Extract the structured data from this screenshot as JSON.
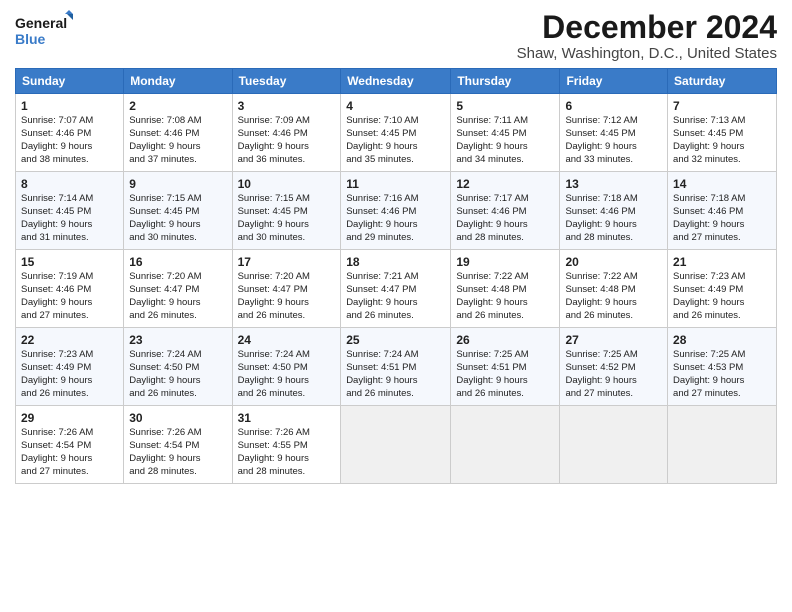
{
  "logo": {
    "line1": "General",
    "line2": "Blue"
  },
  "title": "December 2024",
  "location": "Shaw, Washington, D.C., United States",
  "days_of_week": [
    "Sunday",
    "Monday",
    "Tuesday",
    "Wednesday",
    "Thursday",
    "Friday",
    "Saturday"
  ],
  "weeks": [
    [
      {
        "day": "1",
        "info": "Sunrise: 7:07 AM\nSunset: 4:46 PM\nDaylight: 9 hours\nand 38 minutes."
      },
      {
        "day": "2",
        "info": "Sunrise: 7:08 AM\nSunset: 4:46 PM\nDaylight: 9 hours\nand 37 minutes."
      },
      {
        "day": "3",
        "info": "Sunrise: 7:09 AM\nSunset: 4:46 PM\nDaylight: 9 hours\nand 36 minutes."
      },
      {
        "day": "4",
        "info": "Sunrise: 7:10 AM\nSunset: 4:45 PM\nDaylight: 9 hours\nand 35 minutes."
      },
      {
        "day": "5",
        "info": "Sunrise: 7:11 AM\nSunset: 4:45 PM\nDaylight: 9 hours\nand 34 minutes."
      },
      {
        "day": "6",
        "info": "Sunrise: 7:12 AM\nSunset: 4:45 PM\nDaylight: 9 hours\nand 33 minutes."
      },
      {
        "day": "7",
        "info": "Sunrise: 7:13 AM\nSunset: 4:45 PM\nDaylight: 9 hours\nand 32 minutes."
      }
    ],
    [
      {
        "day": "8",
        "info": "Sunrise: 7:14 AM\nSunset: 4:45 PM\nDaylight: 9 hours\nand 31 minutes."
      },
      {
        "day": "9",
        "info": "Sunrise: 7:15 AM\nSunset: 4:45 PM\nDaylight: 9 hours\nand 30 minutes."
      },
      {
        "day": "10",
        "info": "Sunrise: 7:15 AM\nSunset: 4:45 PM\nDaylight: 9 hours\nand 30 minutes."
      },
      {
        "day": "11",
        "info": "Sunrise: 7:16 AM\nSunset: 4:46 PM\nDaylight: 9 hours\nand 29 minutes."
      },
      {
        "day": "12",
        "info": "Sunrise: 7:17 AM\nSunset: 4:46 PM\nDaylight: 9 hours\nand 28 minutes."
      },
      {
        "day": "13",
        "info": "Sunrise: 7:18 AM\nSunset: 4:46 PM\nDaylight: 9 hours\nand 28 minutes."
      },
      {
        "day": "14",
        "info": "Sunrise: 7:18 AM\nSunset: 4:46 PM\nDaylight: 9 hours\nand 27 minutes."
      }
    ],
    [
      {
        "day": "15",
        "info": "Sunrise: 7:19 AM\nSunset: 4:46 PM\nDaylight: 9 hours\nand 27 minutes."
      },
      {
        "day": "16",
        "info": "Sunrise: 7:20 AM\nSunset: 4:47 PM\nDaylight: 9 hours\nand 26 minutes."
      },
      {
        "day": "17",
        "info": "Sunrise: 7:20 AM\nSunset: 4:47 PM\nDaylight: 9 hours\nand 26 minutes."
      },
      {
        "day": "18",
        "info": "Sunrise: 7:21 AM\nSunset: 4:47 PM\nDaylight: 9 hours\nand 26 minutes."
      },
      {
        "day": "19",
        "info": "Sunrise: 7:22 AM\nSunset: 4:48 PM\nDaylight: 9 hours\nand 26 minutes."
      },
      {
        "day": "20",
        "info": "Sunrise: 7:22 AM\nSunset: 4:48 PM\nDaylight: 9 hours\nand 26 minutes."
      },
      {
        "day": "21",
        "info": "Sunrise: 7:23 AM\nSunset: 4:49 PM\nDaylight: 9 hours\nand 26 minutes."
      }
    ],
    [
      {
        "day": "22",
        "info": "Sunrise: 7:23 AM\nSunset: 4:49 PM\nDaylight: 9 hours\nand 26 minutes."
      },
      {
        "day": "23",
        "info": "Sunrise: 7:24 AM\nSunset: 4:50 PM\nDaylight: 9 hours\nand 26 minutes."
      },
      {
        "day": "24",
        "info": "Sunrise: 7:24 AM\nSunset: 4:50 PM\nDaylight: 9 hours\nand 26 minutes."
      },
      {
        "day": "25",
        "info": "Sunrise: 7:24 AM\nSunset: 4:51 PM\nDaylight: 9 hours\nand 26 minutes."
      },
      {
        "day": "26",
        "info": "Sunrise: 7:25 AM\nSunset: 4:51 PM\nDaylight: 9 hours\nand 26 minutes."
      },
      {
        "day": "27",
        "info": "Sunrise: 7:25 AM\nSunset: 4:52 PM\nDaylight: 9 hours\nand 27 minutes."
      },
      {
        "day": "28",
        "info": "Sunrise: 7:25 AM\nSunset: 4:53 PM\nDaylight: 9 hours\nand 27 minutes."
      }
    ],
    [
      {
        "day": "29",
        "info": "Sunrise: 7:26 AM\nSunset: 4:54 PM\nDaylight: 9 hours\nand 27 minutes."
      },
      {
        "day": "30",
        "info": "Sunrise: 7:26 AM\nSunset: 4:54 PM\nDaylight: 9 hours\nand 28 minutes."
      },
      {
        "day": "31",
        "info": "Sunrise: 7:26 AM\nSunset: 4:55 PM\nDaylight: 9 hours\nand 28 minutes."
      },
      {
        "day": "",
        "info": ""
      },
      {
        "day": "",
        "info": ""
      },
      {
        "day": "",
        "info": ""
      },
      {
        "day": "",
        "info": ""
      }
    ]
  ]
}
